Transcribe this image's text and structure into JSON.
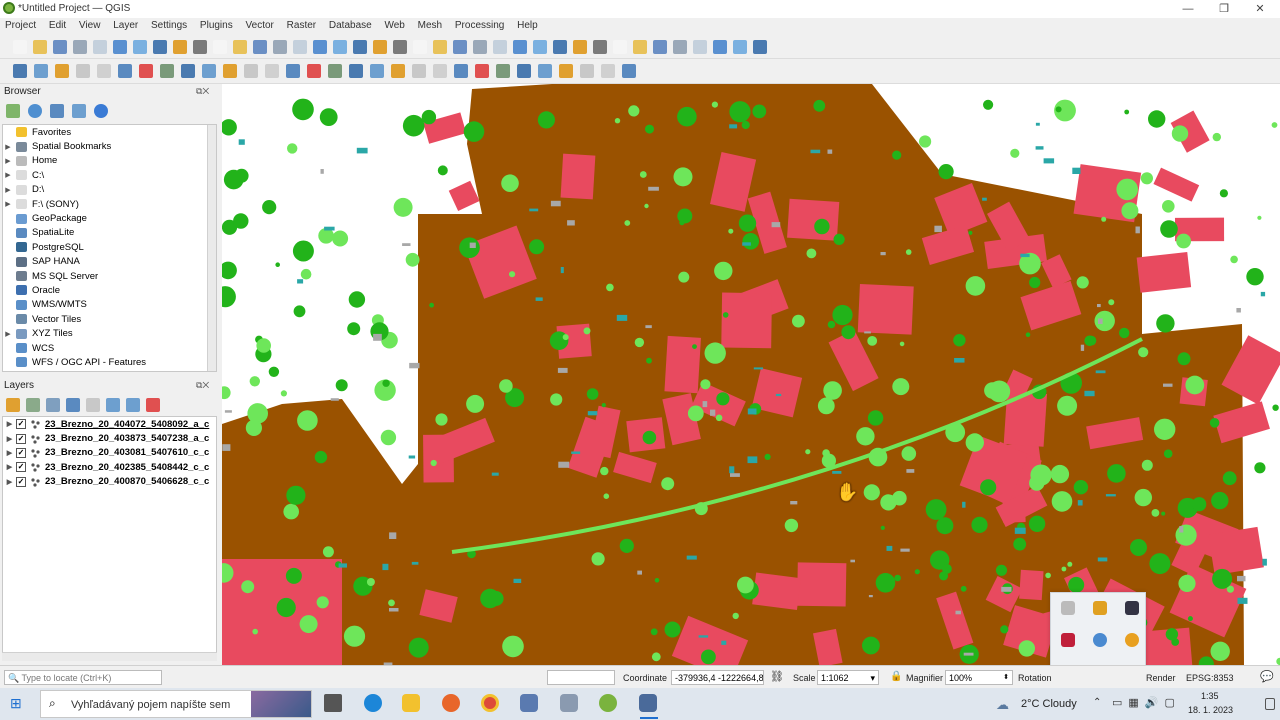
{
  "window": {
    "title": "*Untitled Project — QGIS"
  },
  "menu": [
    "Project",
    "Edit",
    "View",
    "Layer",
    "Settings",
    "Plugins",
    "Vector",
    "Raster",
    "Database",
    "Web",
    "Mesh",
    "Processing",
    "Help"
  ],
  "browser": {
    "title": "Browser",
    "items": [
      {
        "label": "Favorites",
        "icon": "star-icon",
        "color": "#f2c12e",
        "expand": ""
      },
      {
        "label": "Spatial Bookmarks",
        "icon": "bookmark-icon",
        "color": "#7a8a9a",
        "expand": "▶"
      },
      {
        "label": "Home",
        "icon": "home-folder-icon",
        "color": "#bbbbbb",
        "expand": "▶"
      },
      {
        "label": "C:\\",
        "icon": "folder-icon",
        "color": "#dcdcdc",
        "expand": "▶"
      },
      {
        "label": "D:\\",
        "icon": "folder-icon",
        "color": "#dcdcdc",
        "expand": "▶"
      },
      {
        "label": "F:\\ (SONY)",
        "icon": "folder-icon",
        "color": "#dcdcdc",
        "expand": "▶"
      },
      {
        "label": "GeoPackage",
        "icon": "geopackage-icon",
        "color": "#6a9bd1",
        "expand": ""
      },
      {
        "label": "SpatiaLite",
        "icon": "spatialite-icon",
        "color": "#5a8ac0",
        "expand": ""
      },
      {
        "label": "PostgreSQL",
        "icon": "postgresql-icon",
        "color": "#336791",
        "expand": ""
      },
      {
        "label": "SAP HANA",
        "icon": "sap-hana-icon",
        "color": "#5c6f85",
        "expand": ""
      },
      {
        "label": "MS SQL Server",
        "icon": "mssql-icon",
        "color": "#6d7c8e",
        "expand": ""
      },
      {
        "label": "Oracle",
        "icon": "oracle-icon",
        "color": "#3d6faf",
        "expand": ""
      },
      {
        "label": "WMS/WMTS",
        "icon": "wms-globe-icon",
        "color": "#5a8fc8",
        "expand": ""
      },
      {
        "label": "Vector Tiles",
        "icon": "vector-tiles-icon",
        "color": "#6a8aa8",
        "expand": ""
      },
      {
        "label": "XYZ Tiles",
        "icon": "xyz-tiles-icon",
        "color": "#7a9ac0",
        "expand": "▶"
      },
      {
        "label": "WCS",
        "icon": "wcs-globe-icon",
        "color": "#5a8fc8",
        "expand": ""
      },
      {
        "label": "WFS / OGC API - Features",
        "icon": "wfs-globe-icon",
        "color": "#5a8fc8",
        "expand": ""
      }
    ]
  },
  "layers": {
    "title": "Layers",
    "items": [
      {
        "name": "23_Brezno_20_404072_5408092_a_c",
        "checked": "✓",
        "expand": "▶"
      },
      {
        "name": "23_Brezno_20_403873_5407238_a_c",
        "checked": "✓",
        "expand": "▶"
      },
      {
        "name": "23_Brezno_20_403081_5407610_c_c",
        "checked": "✓",
        "expand": "▶"
      },
      {
        "name": "23_Brezno_20_402385_5408442_c_c",
        "checked": "✓",
        "expand": "▶"
      },
      {
        "name": "23_Brezno_20_400870_5406628_c_c",
        "checked": "✓",
        "expand": "▶"
      }
    ]
  },
  "status": {
    "locate_placeholder": "Type to locate (Ctrl+K)",
    "coordinate_label": "Coordinate",
    "coordinate_value": "-379936,4 -1222664,8",
    "scale_label": "Scale",
    "scale_value": "1:1062",
    "magnifier_label": "Magnifier",
    "magnifier_value": "100%",
    "rotation_label": "Rotation",
    "render_label": "Render",
    "crs": "EPSG:8353"
  },
  "taskbar": {
    "search_placeholder": "Vyhľadávaný pojem napíšte sem",
    "weather": "2°C  Cloudy",
    "time": "1:35",
    "date": "18. 1. 2023"
  },
  "map_colors": {
    "ground": "#9a5200",
    "building": "#e84a5f",
    "vegetation_high": "#22b31a",
    "vegetation_low": "#6ee65a",
    "unclassified": "#a8a8a8",
    "water": "#2aa7a7"
  }
}
